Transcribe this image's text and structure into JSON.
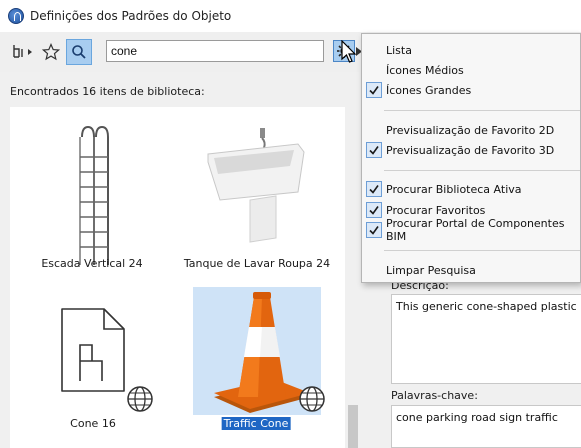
{
  "window": {
    "title": "Definições dos Padrões do Objeto"
  },
  "toolbar": {
    "search_value": "cone",
    "icons": [
      "library-tree-icon",
      "star-icon",
      "search-icon",
      "gear-icon"
    ]
  },
  "results": {
    "found_label": "Encontrados 16 itens de biblioteca:",
    "items": [
      {
        "label": "Escada Vertical 24",
        "icon": "ladder-image",
        "selected": false
      },
      {
        "label": "Tanque de Lavar Roupa 24",
        "icon": "utility-sink-image",
        "selected": false
      },
      {
        "label": "Cone 16",
        "icon": "chair-file-icon",
        "selected": false
      },
      {
        "label": "Traffic Cone",
        "icon": "traffic-cone-image",
        "selected": true
      }
    ]
  },
  "details": {
    "description_label": "Descrição:",
    "description_value": "This generic cone-shaped plastic ma",
    "keywords_label": "Palavras-chave:",
    "keywords_value": "cone parking road sign traffic"
  },
  "menu": {
    "items": [
      {
        "label": "Lista",
        "checked": false
      },
      {
        "label": "Ícones Médios",
        "checked": false
      },
      {
        "label": "Ícones Grandes",
        "checked": true
      },
      {
        "label": "Previsualização de Favorito 2D",
        "checked": false
      },
      {
        "label": "Previsualização de Favorito 3D",
        "checked": true
      },
      {
        "label": "Procurar Biblioteca Ativa",
        "checked": true
      },
      {
        "label": "Procurar Favoritos",
        "checked": true
      },
      {
        "label": "Procurar Portal de Componentes BIM",
        "checked": true
      },
      {
        "label": "Limpar Pesquisa",
        "checked": false
      }
    ]
  },
  "colors": {
    "accent": "#1e66c4",
    "selection_bg": "#cfe3f7",
    "cone_orange": "#e2650f"
  }
}
